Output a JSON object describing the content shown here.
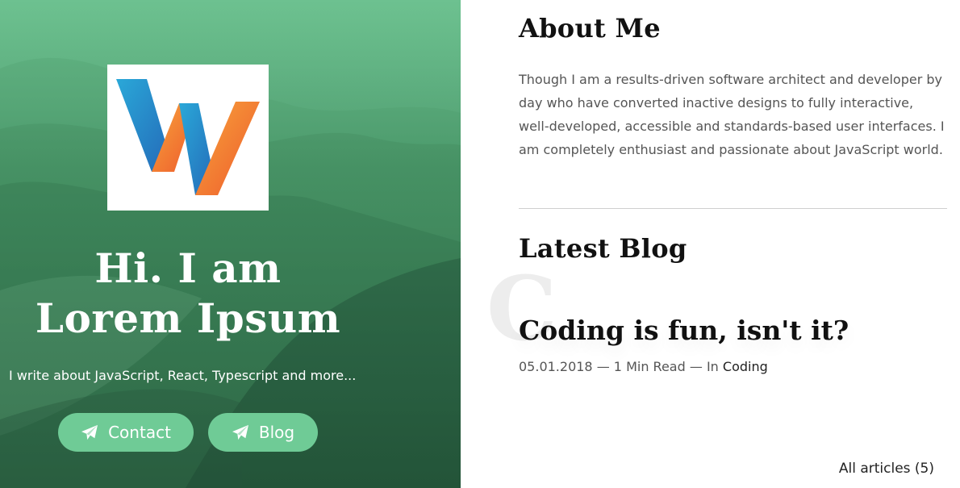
{
  "hero": {
    "title_line1": "Hi. I am",
    "title_line2": "Lorem Ipsum",
    "subtitle": "I write about JavaScript, React, Typescript and more...",
    "logo_icon": "w-letter-logo",
    "contact_label": "Contact",
    "blog_label": "Blog",
    "button_icon": "paper-plane-icon",
    "button_color": "#6fcb96"
  },
  "about": {
    "heading": "About Me",
    "text": "Though I am a results-driven software architect and developer by day who have converted inactive designs to fully interactive, well-developed, accessible and standards-based user interfaces. I am completely enthusiast and passionate about JavaScript world."
  },
  "blog": {
    "heading": "Latest Blog",
    "post": {
      "watermark_letter": "C",
      "title": "Coding is fun, isn't it?",
      "date": "05.01.2018",
      "read_time": "1 Min Read",
      "category_prefix": "In",
      "category": "Coding"
    },
    "all_articles_label": "All articles (5)"
  }
}
